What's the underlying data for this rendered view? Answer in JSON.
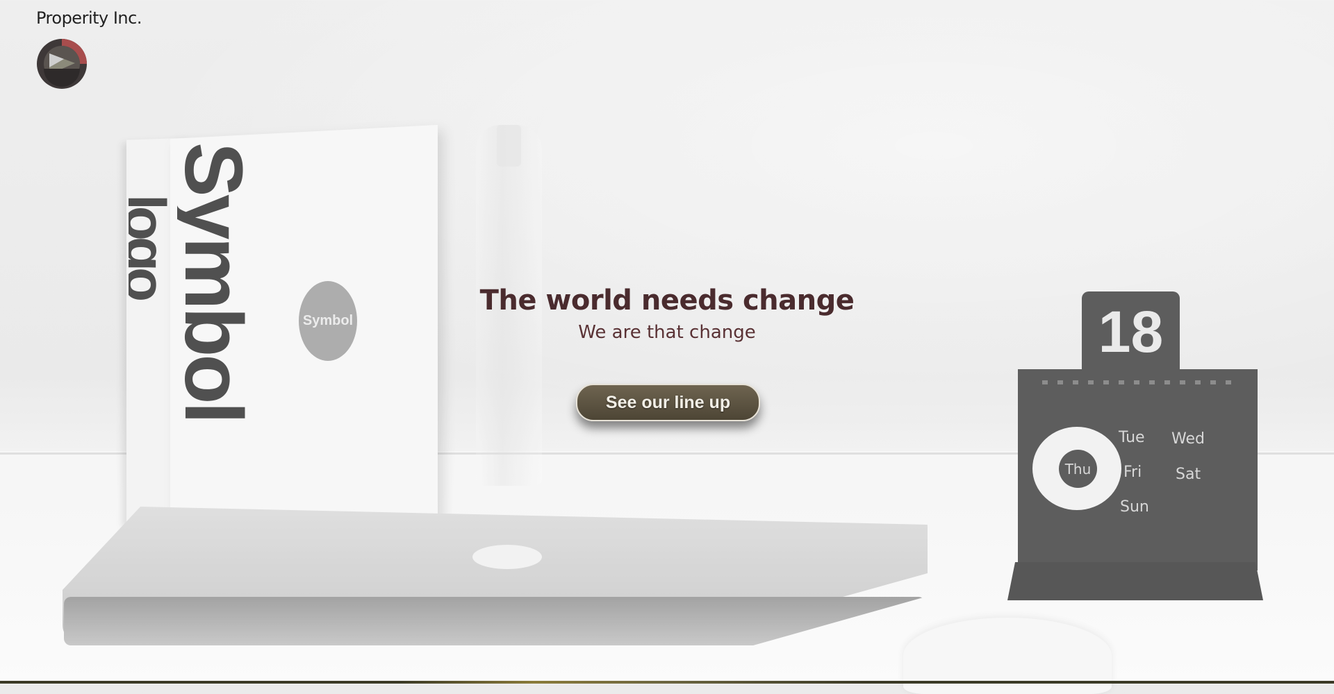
{
  "brand": {
    "name": "Properity Inc.",
    "logo_icon": "play-triangle-logo-icon"
  },
  "hero": {
    "title": "The world needs change",
    "subtitle": "We are that change",
    "cta_label": "See our line up"
  },
  "background": {
    "book_spine_text": "Symbol",
    "book2_spine_text": "logo",
    "book_seal_text": "Symbol",
    "calendar_day": "18",
    "calendar_circle_day": "Thu",
    "calendar_days": [
      "Tue",
      "Wed",
      "Fri",
      "Sat",
      "Sun"
    ]
  },
  "colors": {
    "title": "#4a2b2e",
    "button_bg": "#5a5140",
    "button_border": "#e7e2d7"
  }
}
